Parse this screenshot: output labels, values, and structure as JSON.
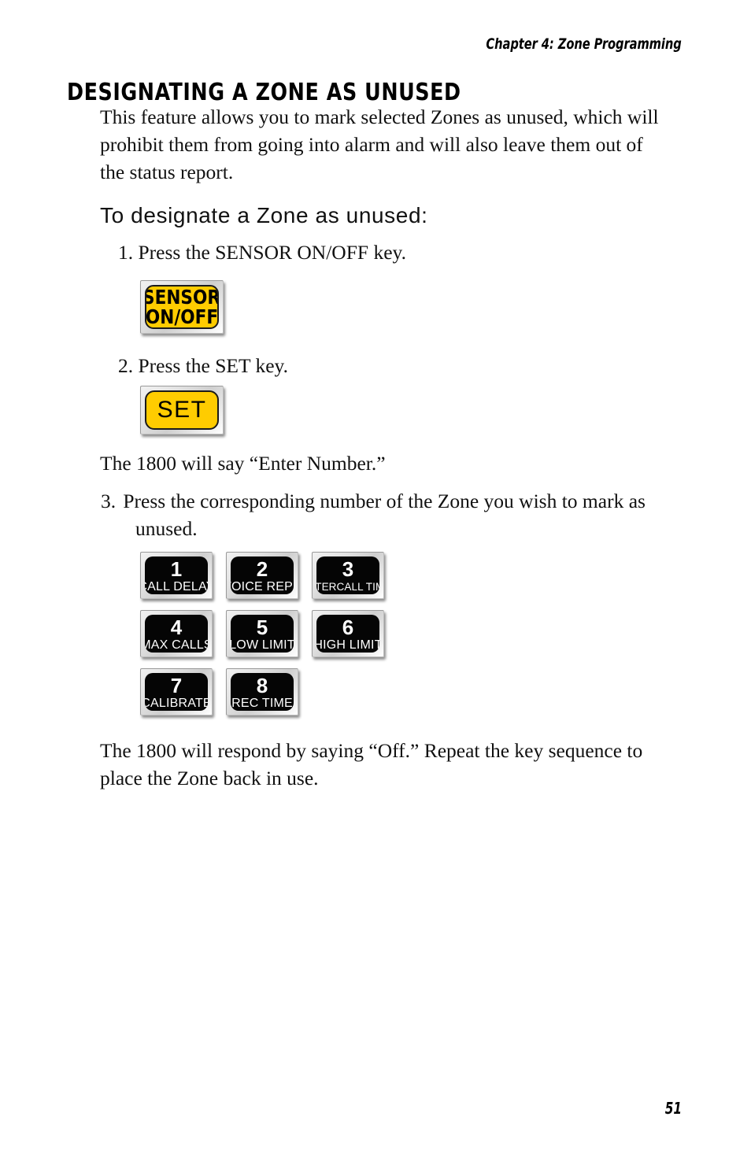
{
  "header": {
    "running_head": "Chapter 4: Zone Programming"
  },
  "title": "DESIGNATING A ZONE AS UNUSED",
  "intro_paragraph": "This feature allows you to mark selected Zones as unused, which will prohibit them from going into alarm and will also leave them out of the status report.",
  "sub_heading": "To designate a Zone as unused:",
  "steps": [
    {
      "number": "1.",
      "text": "Press the SENSOR ON/OFF key."
    },
    {
      "number": "2.",
      "text": "Press the SET key."
    },
    {
      "number": "3.",
      "text": "Press the corresponding number of the Zone you wish to mark as unused."
    }
  ],
  "note_after_step2": "The 1800 will say “Enter Number.”",
  "closing_paragraph": "The 1800 will respond by saying “Off.”  Repeat the key sequence to place the Zone back in use.",
  "keys": {
    "sensor_on_off": {
      "line1": "SENSOR",
      "line2": "ON/OFF",
      "face_color": "#FFCC00",
      "text_color": "#000000"
    },
    "set": {
      "line1": "SET",
      "face_color": "#FFCC00",
      "text_color": "#000000"
    },
    "numeric": [
      {
        "number": "1",
        "label": "CALL DELAY"
      },
      {
        "number": "2",
        "label": "VOICE REPS"
      },
      {
        "number": "3",
        "label": "INTERCALL TIME"
      },
      {
        "number": "4",
        "label": "MAX CALLS"
      },
      {
        "number": "5",
        "label": "LOW LIMIT"
      },
      {
        "number": "6",
        "label": "HIGH LIMIT"
      },
      {
        "number": "7",
        "label": "CALIBRATE"
      },
      {
        "number": "8",
        "label": "REC TIME"
      }
    ],
    "numeric_face_color": "#050505",
    "numeric_text_color": "#FFFFFF"
  },
  "page_number": "51"
}
